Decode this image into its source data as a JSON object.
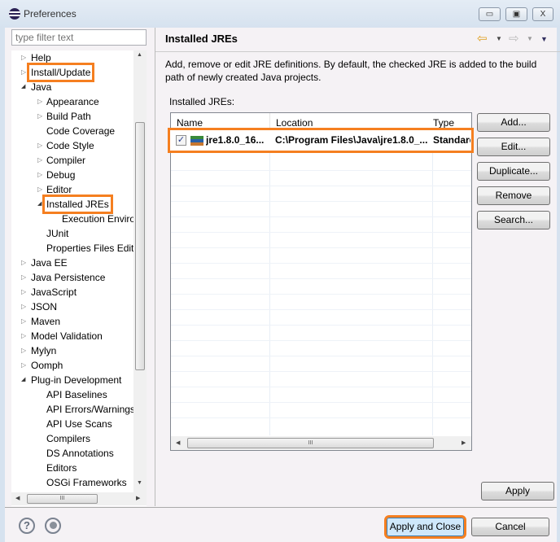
{
  "window": {
    "title": "Preferences",
    "minimize": "▭",
    "maximize": "▣",
    "close": "X"
  },
  "filter": {
    "placeholder": "type filter text"
  },
  "tree": [
    {
      "label": "Help",
      "level": 0,
      "state": "collapsed"
    },
    {
      "label": "Install/Update",
      "level": 0,
      "state": "collapsed",
      "highlight": true
    },
    {
      "label": "Java",
      "level": 0,
      "state": "expanded"
    },
    {
      "label": "Appearance",
      "level": 1,
      "state": "collapsed"
    },
    {
      "label": "Build Path",
      "level": 1,
      "state": "collapsed"
    },
    {
      "label": "Code Coverage",
      "level": 1,
      "state": "leaf"
    },
    {
      "label": "Code Style",
      "level": 1,
      "state": "collapsed"
    },
    {
      "label": "Compiler",
      "level": 1,
      "state": "collapsed"
    },
    {
      "label": "Debug",
      "level": 1,
      "state": "collapsed"
    },
    {
      "label": "Editor",
      "level": 1,
      "state": "collapsed"
    },
    {
      "label": "Installed JREs",
      "level": 1,
      "state": "expanded",
      "highlight": true
    },
    {
      "label": "Execution Enviro",
      "level": 2,
      "state": "leaf"
    },
    {
      "label": "JUnit",
      "level": 1,
      "state": "leaf"
    },
    {
      "label": "Properties Files Edito",
      "level": 1,
      "state": "leaf"
    },
    {
      "label": "Java EE",
      "level": 0,
      "state": "collapsed"
    },
    {
      "label": "Java Persistence",
      "level": 0,
      "state": "collapsed"
    },
    {
      "label": "JavaScript",
      "level": 0,
      "state": "collapsed"
    },
    {
      "label": "JSON",
      "level": 0,
      "state": "collapsed"
    },
    {
      "label": "Maven",
      "level": 0,
      "state": "collapsed"
    },
    {
      "label": "Model Validation",
      "level": 0,
      "state": "collapsed"
    },
    {
      "label": "Mylyn",
      "level": 0,
      "state": "collapsed"
    },
    {
      "label": "Oomph",
      "level": 0,
      "state": "collapsed"
    },
    {
      "label": "Plug-in Development",
      "level": 0,
      "state": "expanded"
    },
    {
      "label": "API Baselines",
      "level": 1,
      "state": "leaf"
    },
    {
      "label": "API Errors/Warnings",
      "level": 1,
      "state": "leaf"
    },
    {
      "label": "API Use Scans",
      "level": 1,
      "state": "leaf"
    },
    {
      "label": "Compilers",
      "level": 1,
      "state": "leaf"
    },
    {
      "label": "DS Annotations",
      "level": 1,
      "state": "leaf"
    },
    {
      "label": "Editors",
      "level": 1,
      "state": "leaf"
    },
    {
      "label": "OSGi Frameworks",
      "level": 1,
      "state": "leaf"
    }
  ],
  "page": {
    "title": "Installed JREs",
    "description": "Add, remove or edit JRE definitions. By default, the checked JRE is added to the build path of newly created Java projects.",
    "list_label": "Installed JREs:",
    "columns": [
      "Name",
      "Location",
      "Type"
    ],
    "rows": [
      {
        "checked": true,
        "name": "jre1.8.0_16...",
        "location": "C:\\Program Files\\Java\\jre1.8.0_...",
        "type": "Standard"
      }
    ],
    "buttons": [
      "Add...",
      "Edit...",
      "Duplicate...",
      "Remove",
      "Search..."
    ],
    "apply": "Apply"
  },
  "footer": {
    "apply_close": "Apply and Close",
    "cancel": "Cancel",
    "help": "?"
  },
  "colors": {
    "highlight": "#f57f20",
    "apply_close_bg": "#cfe8fb"
  }
}
